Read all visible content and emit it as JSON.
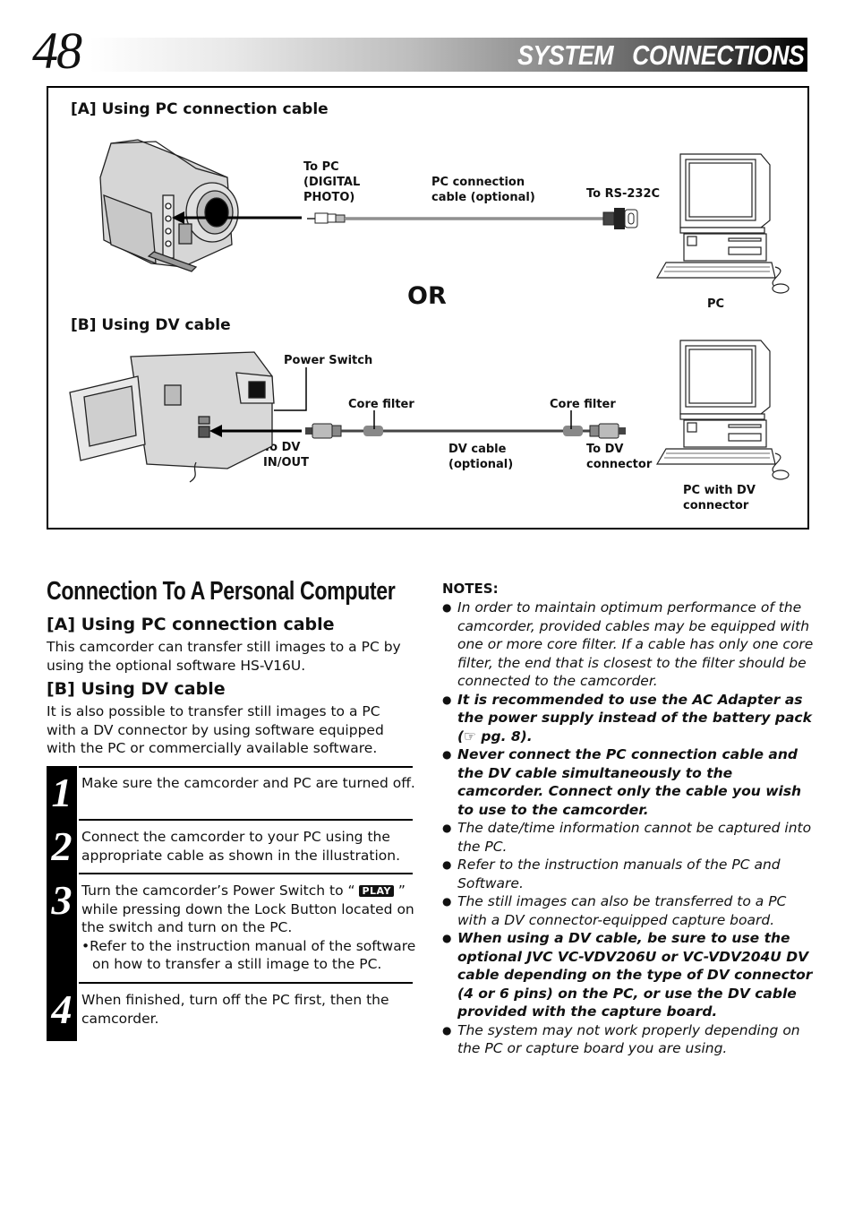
{
  "header": {
    "page_number": "48",
    "section_title": "SYSTEM   CONNECTIONS"
  },
  "diagram": {
    "section_a_title": "[A] Using PC connection cable",
    "section_b_title": "[B] Using DV cable",
    "or_label": "OR",
    "a_labels": {
      "to_pc_line1": "To PC",
      "to_pc_line2": "(DIGITAL",
      "to_pc_line3": "PHOTO)",
      "cable_line1": "PC connection",
      "cable_line2": "cable (optional)",
      "to_rs232c": "To RS-232C",
      "pc": "PC"
    },
    "b_labels": {
      "power_switch": "Power Switch",
      "core_filter_left": "Core filter",
      "core_filter_right": "Core filter",
      "to_dv_in_line1": "To DV",
      "to_dv_in_line2": "IN/OUT",
      "dv_cable_line1": "DV cable",
      "dv_cable_line2": "(optional)",
      "to_dv_conn_line1": "To DV",
      "to_dv_conn_line2": "connector",
      "pc_dv_line1": "PC with DV",
      "pc_dv_line2": "connector"
    },
    "icons": {
      "camcorder_a": "camcorder-icon",
      "camcorder_b": "camcorder-lcd-open-icon",
      "pc": "desktop-pc-icon",
      "plug_mini": "mini-plug-icon",
      "plug_rs232": "rs232-connector-icon",
      "plug_dv": "dv-plug-icon",
      "core_filter": "core-filter-icon"
    }
  },
  "main": {
    "title": "Connection To A Personal Computer",
    "sub_a_title": "[A] Using PC connection cable",
    "sub_a_body": "This camcorder can transfer still images to a PC by using the optional software HS-V16U.",
    "sub_b_title": "[B] Using DV cable",
    "sub_b_body": "It is also possible to transfer still images to a PC with a DV connector by using software equipped with the PC or commercially available software.",
    "steps": [
      {
        "num": "1",
        "text": "Make sure the camcorder and PC are turned off."
      },
      {
        "num": "2",
        "text": "Connect the camcorder to your PC using the appropriate cable as shown in the illustration."
      },
      {
        "num": "3",
        "text_before": "Turn the camcorder’s Power Switch to “ ",
        "badge": "PLAY",
        "text_after": " ” while pressing down the Lock Button located on the switch and turn on the PC.",
        "sub_bullet": "Refer to the instruction manual of the software on how to transfer a still image to the PC."
      },
      {
        "num": "4",
        "text": "When finished, turn off the PC first, then the camcorder."
      }
    ]
  },
  "notes": {
    "heading": "NOTES:",
    "items": [
      {
        "text": "In order to maintain optimum performance of the camcorder, provided cables may be equipped with one or more core filter. If a cable has only one core filter, the end that is closest to the filter should be connected to the camcorder.",
        "bold": false
      },
      {
        "text": "It is recommended to use the AC Adapter as the power supply instead of the battery pack (☞ pg. 8).",
        "bold": true
      },
      {
        "text": "Never connect the PC connection cable and the DV cable simultaneously to the camcorder. Connect only the cable you wish to use to the camcorder.",
        "bold": true
      },
      {
        "text": "The date/time information cannot be captured into the PC.",
        "bold": false
      },
      {
        "text": "Refer to the instruction manuals of the PC and Software.",
        "bold": false
      },
      {
        "text": "The still images can also be transferred to a PC with a DV connector-equipped capture board.",
        "bold": false
      },
      {
        "text": "When using a DV cable, be sure to use the optional JVC VC-VDV206U or VC-VDV204U DV cable depending on the type of DV connector (4 or 6 pins) on the PC, or use the DV cable provided with the capture board.",
        "bold": true
      },
      {
        "text": "The system may not work properly depending on the PC or capture board you are using.",
        "bold": false
      }
    ]
  }
}
